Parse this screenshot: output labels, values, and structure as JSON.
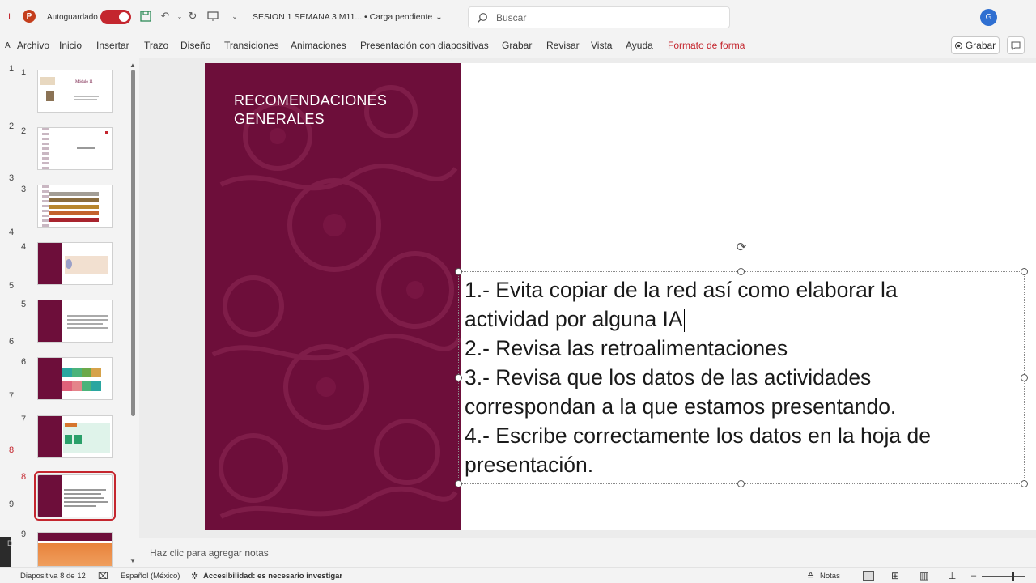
{
  "titlebar": {
    "app_icon": "powerpoint-icon",
    "autosave_label": "Autoguardado",
    "autosave_on": true,
    "doc_title": "SESION 1 SEMANA 3 M11...",
    "doc_status": "• Carga pendiente",
    "search_placeholder": "Buscar",
    "user_initial": "G",
    "icons": [
      "save-icon",
      "undo-icon",
      "redo-icon",
      "present-icon",
      "customize-icon"
    ]
  },
  "ribbon": {
    "tabs": [
      "Archivo",
      "Inicio",
      "Insertar",
      "Trazo",
      "Diseño",
      "Transiciones",
      "Animaciones",
      "Presentación con diapositivas",
      "Grabar",
      "Revisar",
      "Vista",
      "Ayuda",
      "Formato de forma"
    ],
    "record_button": "Grabar",
    "accent_color": "#c4262e"
  },
  "thumbnails": {
    "numbers": [
      "1",
      "2",
      "3",
      "4",
      "5",
      "6",
      "7",
      "8",
      "9"
    ],
    "active_index": 8,
    "slide1_title": "Módulo 11"
  },
  "slide": {
    "panel_title": "RECOMENDACIONES GENERALES",
    "panel_color": "#6d0e3a",
    "lines": [
      "1.-  Evita copiar de la red así como elaborar la",
      "actividad por alguna IA",
      "2.- Revisa las retroalimentaciones",
      "3.- Revisa que los datos de las actividades",
      "correspondan a la que estamos presentando.",
      "4.- Escribe correctamente los datos en la hoja de",
      "presentación."
    ]
  },
  "notes": {
    "placeholder": "Haz clic para agregar notas"
  },
  "status": {
    "slide_counter": "Diapositiva 8 de 12",
    "language": "Español (México)",
    "accessibility": "Accesibilidad: es necesario investigar",
    "notes_label": "Notas"
  }
}
